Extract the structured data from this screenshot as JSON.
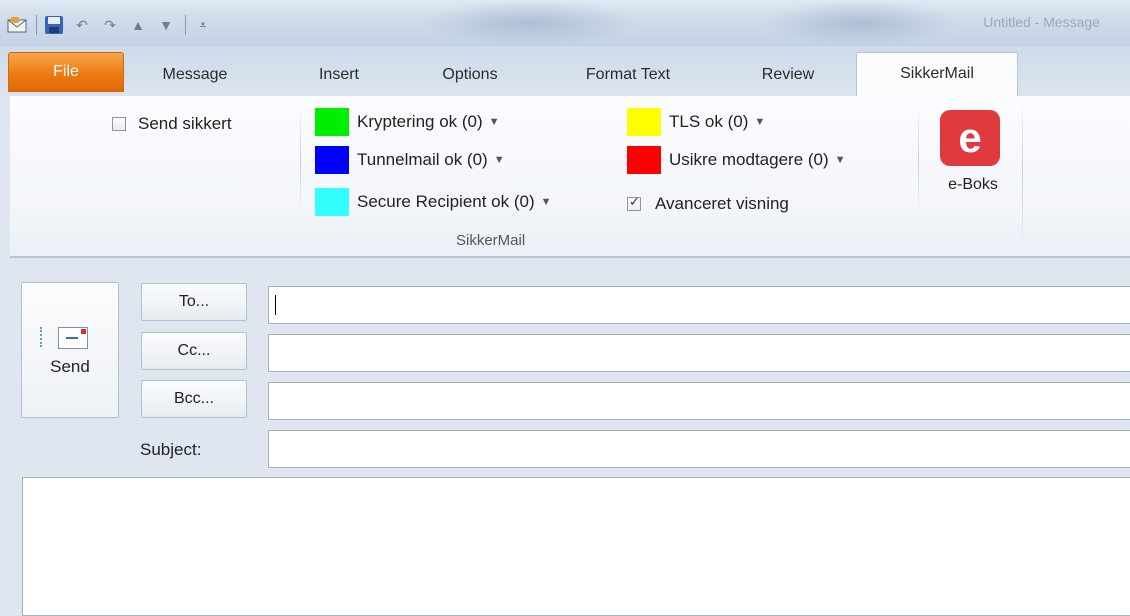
{
  "qat": {
    "icons": [
      "outlook-icon",
      "save-icon",
      "undo-icon",
      "redo-icon",
      "up-arrow-icon",
      "down-arrow-icon",
      "customize-qat-icon"
    ]
  },
  "window": {
    "title": "Untitled - Message"
  },
  "tabs": [
    {
      "label": "File"
    },
    {
      "label": "Message"
    },
    {
      "label": "Insert"
    },
    {
      "label": "Options"
    },
    {
      "label": "Format Text"
    },
    {
      "label": "Review"
    },
    {
      "label": "SikkerMail"
    }
  ],
  "ribbon": {
    "send_sikkert": {
      "label": "Send sikkert",
      "checked": false
    },
    "items": [
      {
        "label": "Kryptering ok (0)",
        "color": "#00ee00"
      },
      {
        "label": "Tunnelmail ok (0)",
        "color": "#0000ff"
      },
      {
        "label": "Secure Recipient ok (0)",
        "color": "#33ffff"
      },
      {
        "label": "TLS ok (0)",
        "color": "#ffff00"
      },
      {
        "label": "Usikre modtagere (0)",
        "color": "#ff0000"
      }
    ],
    "avanceret": {
      "label": "Avanceret visning",
      "checked": true
    },
    "group_label": "SikkerMail",
    "eboks": {
      "letter": "e",
      "label": "e-Boks"
    }
  },
  "compose": {
    "send_label": "Send",
    "to_label": "To...",
    "cc_label": "Cc...",
    "bcc_label": "Bcc...",
    "subject_label": "Subject:",
    "to_value": "",
    "cc_value": "",
    "bcc_value": "",
    "subject_value": ""
  }
}
